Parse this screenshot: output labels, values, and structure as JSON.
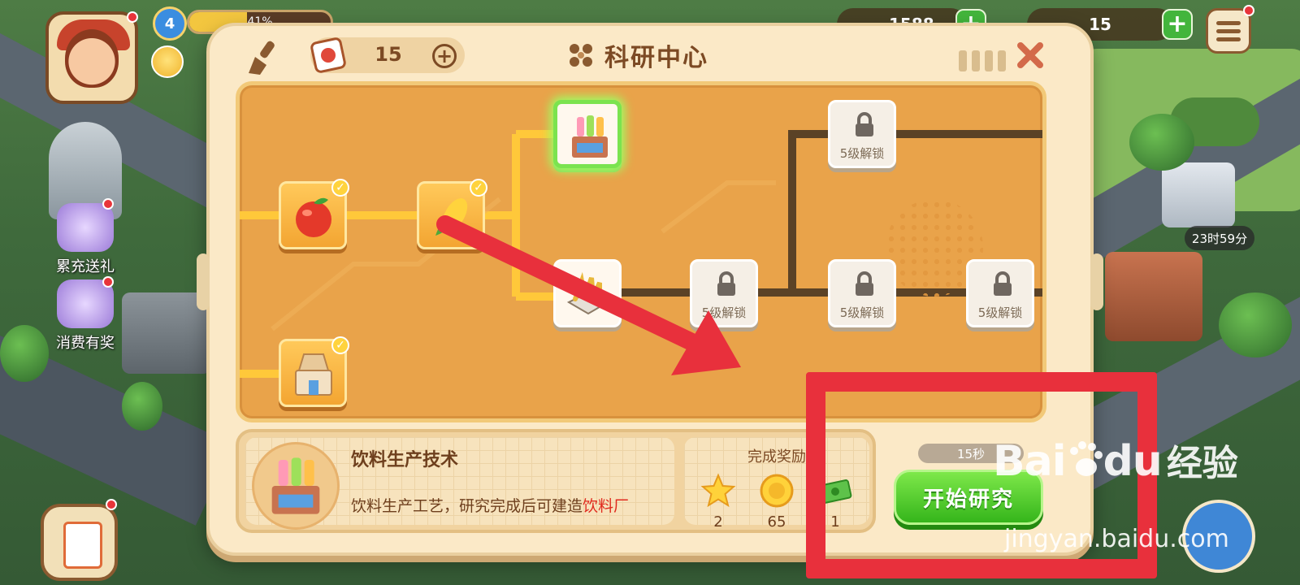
{
  "hud": {
    "level": "4",
    "xp_fraction": 0.41,
    "xp_label": "41%",
    "coins_partial": "1588",
    "cash": "15"
  },
  "side_promos": [
    {
      "label": "累充送礼"
    },
    {
      "label": "消费有奖"
    }
  ],
  "timer_bubble": "23时59分",
  "dialog": {
    "title": "科研中心",
    "seed_count": "15",
    "seed_plus": "+",
    "nodes": [
      {
        "name": "apple",
        "state": "done"
      },
      {
        "name": "corn",
        "state": "done"
      },
      {
        "name": "flour-mill",
        "state": "done"
      },
      {
        "name": "beverage-factory",
        "state": "selected"
      },
      {
        "name": "grain-processing",
        "state": "available"
      },
      {
        "name": "locked-1",
        "state": "locked",
        "label": "5级解锁"
      },
      {
        "name": "locked-2",
        "state": "locked",
        "label": "5级解锁"
      },
      {
        "name": "locked-3",
        "state": "locked",
        "label": "5级解锁"
      },
      {
        "name": "locked-4",
        "state": "locked",
        "label": "5级解锁"
      }
    ],
    "info": {
      "title": "饮料生产技术",
      "desc_prefix": "饮料生产工艺，研究完成后可建造",
      "desc_highlight": "饮料厂"
    },
    "rewards": {
      "title": "完成奖励",
      "items": [
        {
          "icon": "star-icon",
          "value": "2"
        },
        {
          "icon": "coin-icon",
          "value": "65"
        },
        {
          "icon": "cash-icon",
          "value": "1"
        }
      ]
    },
    "time": "15秒",
    "start_button": "开始研究"
  },
  "watermark": {
    "logo": "Bai",
    "logo2": "du",
    "cn": "经验",
    "url": "jingyan.baidu.com"
  },
  "colors": {
    "accent_green": "#35b51b",
    "annotation_red": "#e8303c",
    "tree_bg": "#e9a34a",
    "path_active": "#ffc83a",
    "path_locked": "#5b4226"
  }
}
